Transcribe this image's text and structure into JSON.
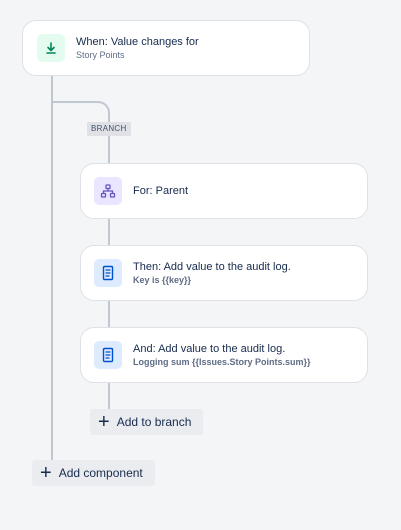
{
  "trigger": {
    "title": "When: Value changes for",
    "subtitle": "Story Points",
    "icon": "field-change-icon"
  },
  "branch_tag": "BRANCH",
  "branch": {
    "condition": {
      "title": "For: Parent",
      "icon": "hierarchy-icon"
    },
    "actions": [
      {
        "title": "Then: Add value to the audit log.",
        "subtitle": "Key is {{key}}",
        "icon": "document-icon"
      },
      {
        "title": "And: Add value to the audit log.",
        "subtitle": "Logging sum {{Issues.Story Points.sum}}",
        "icon": "document-icon"
      }
    ],
    "add_label": "Add to branch"
  },
  "add_component_label": "Add component",
  "colors": {
    "trigger_icon": "#00875a",
    "condition_icon": "#6554c0",
    "action_icon": "#0052cc",
    "connector": "#c1c7d0"
  }
}
